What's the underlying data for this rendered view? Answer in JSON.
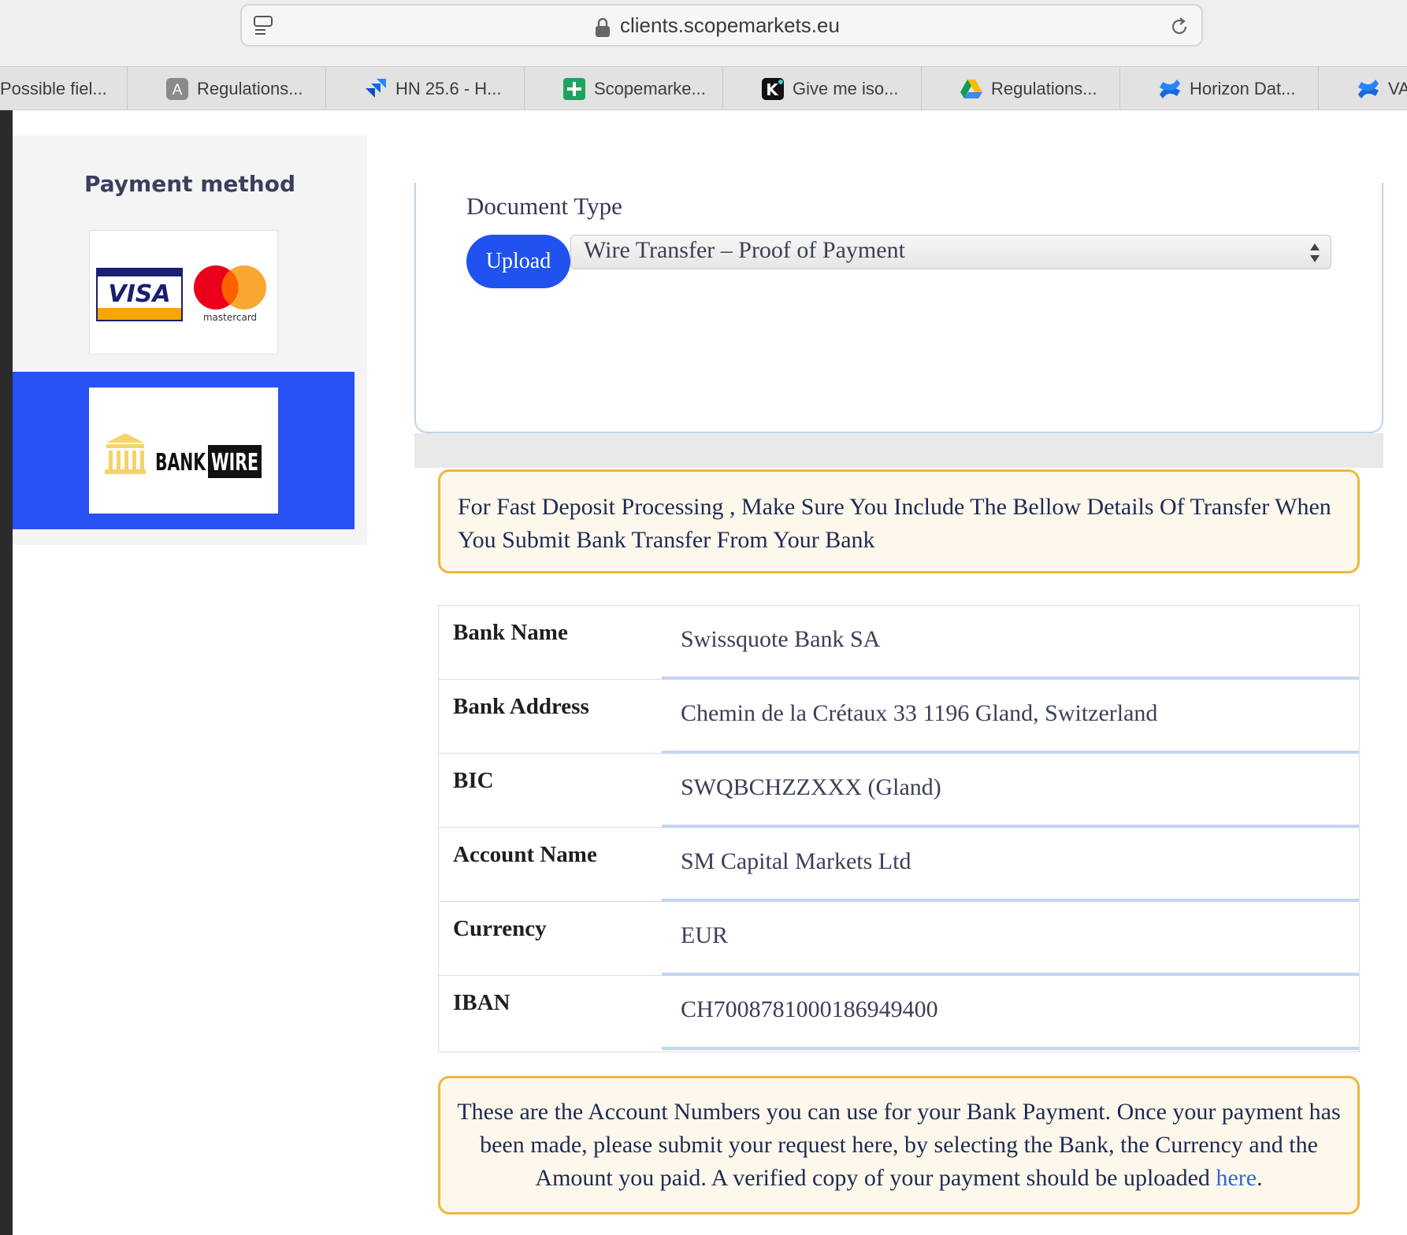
{
  "browser": {
    "url": "clients.scopemarkets.eu",
    "tabs": [
      {
        "label": "Possible fiel...",
        "icon": "none"
      },
      {
        "label": "Regulations...",
        "icon": "letter-a-icon"
      },
      {
        "label": "HN 25.6 - H...",
        "icon": "jira-icon"
      },
      {
        "label": "Scopemarke...",
        "icon": "sheets-icon"
      },
      {
        "label": "Give me iso...",
        "icon": "k-app-icon"
      },
      {
        "label": "Regulations...",
        "icon": "google-drive-icon"
      },
      {
        "label": "Horizon Dat...",
        "icon": "confluence-icon"
      },
      {
        "label": "VA",
        "icon": "confluence-icon"
      }
    ]
  },
  "sidebar": {
    "title": "Payment method",
    "methods": [
      {
        "id": "card",
        "visa_text": "VISA",
        "mastercard_text": "mastercard",
        "active": false
      },
      {
        "id": "bankwire",
        "bank_text": "BANK",
        "wire_text": "WIRE",
        "active": true
      }
    ]
  },
  "upload": {
    "document_type_label": "Document Type",
    "upload_button": "Upload",
    "selected_document": "Wire Transfer – Proof of Payment"
  },
  "notice_top": "For Fast Deposit Processing , Make Sure You Include The Bellow Details Of Transfer When You Submit Bank Transfer From Your Bank",
  "bank_details": [
    {
      "key": "Bank Name",
      "value": "Swissquote Bank SA"
    },
    {
      "key": "Bank Address",
      "value": "Chemin de la Crétaux 33 1196 Gland, Switzerland"
    },
    {
      "key": "BIC",
      "value": "SWQBCHZZXXX (Gland)"
    },
    {
      "key": "Account Name",
      "value": "SM Capital Markets Ltd"
    },
    {
      "key": "Currency",
      "value": "EUR"
    },
    {
      "key": "IBAN",
      "value": "CH7008781000186949400"
    }
  ],
  "notice_bottom": {
    "text": "These are the Account Numbers you can use for your Bank Payment. Once your payment has been made, please submit your request here, by selecting the Bank, the Currency and the Amount you paid. A verified copy of your payment should be uploaded ",
    "link": "here",
    "end": "."
  },
  "colors": {
    "accent_blue": "#2052f0",
    "active_method_bg": "#2852f5",
    "notice_border": "#f0b73c",
    "notice_bg": "#fdf7ec"
  }
}
